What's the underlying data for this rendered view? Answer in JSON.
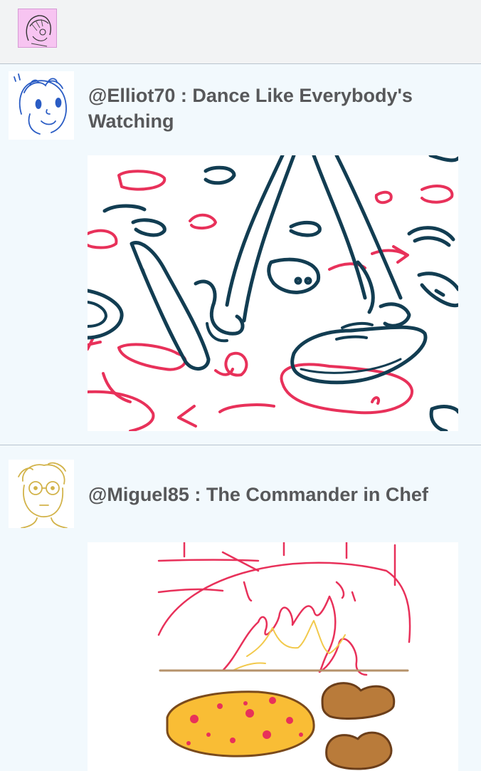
{
  "header": {
    "profile_avatar_icon": "profile-avatar-icon"
  },
  "feed": {
    "posts": [
      {
        "author": "@Elliot70",
        "title": "Dance Like Everybody's",
        "title_line2": "Watching",
        "full_text": "@Elliot70 : Dance Like Everybody's Watching",
        "avatar_icon": "sketch-avatar-icon",
        "artwork": "dancing-feet-sketch"
      },
      {
        "author": "@Miguel85",
        "full_text": "@Miguel85 : The Commander in Chef",
        "avatar_icon": "sketch-avatar-icon",
        "artwork": "pizza-oven-sketch"
      }
    ]
  },
  "colors": {
    "background": "#f2f9fd",
    "title_text": "#57585a",
    "divider": "#b9c4ce",
    "sketch_pink": "#e8315a",
    "sketch_navy": "#123d52",
    "sketch_gold": "#d2b34a",
    "sketch_blue": "#2a5cc4"
  }
}
